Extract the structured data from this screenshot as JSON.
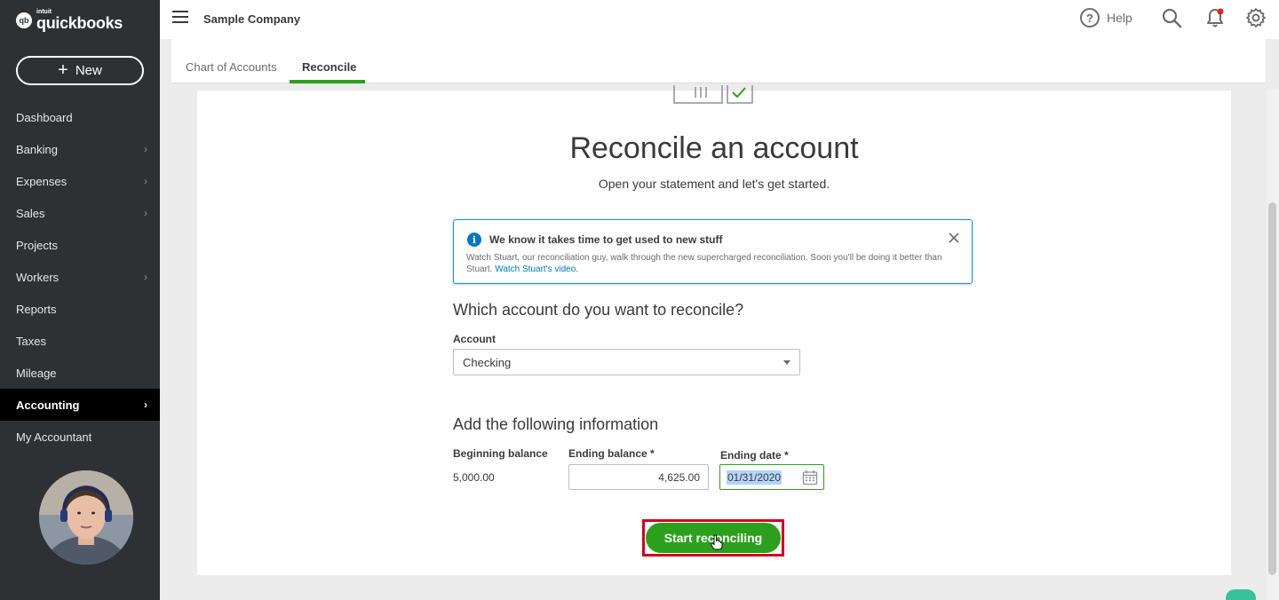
{
  "logo": {
    "intuit": "intuit",
    "brand": "quickbooks"
  },
  "sidebar": {
    "new_label": "New",
    "items": [
      {
        "label": "Dashboard",
        "chevron": false,
        "active": false
      },
      {
        "label": "Banking",
        "chevron": true,
        "active": false
      },
      {
        "label": "Expenses",
        "chevron": true,
        "active": false
      },
      {
        "label": "Sales",
        "chevron": true,
        "active": false
      },
      {
        "label": "Projects",
        "chevron": false,
        "active": false
      },
      {
        "label": "Workers",
        "chevron": true,
        "active": false
      },
      {
        "label": "Reports",
        "chevron": false,
        "active": false
      },
      {
        "label": "Taxes",
        "chevron": false,
        "active": false
      },
      {
        "label": "Mileage",
        "chevron": false,
        "active": false
      },
      {
        "label": "Accounting",
        "chevron": true,
        "active": true
      },
      {
        "label": "My Accountant",
        "chevron": false,
        "active": false
      }
    ]
  },
  "header": {
    "company": "Sample Company",
    "help_label": "Help"
  },
  "tabs": [
    {
      "label": "Chart of Accounts",
      "active": false
    },
    {
      "label": "Reconcile",
      "active": true
    }
  ],
  "main": {
    "title": "Reconcile an account",
    "subtitle": "Open your statement and let's get started.",
    "info": {
      "title": "We know it takes time to get used to new stuff",
      "body": "Watch Stuart, our reconciliation guy, walk through the new supercharged reconciliation. Soon you'll be doing it better than Stuart.",
      "link": "Watch Stuart's video."
    },
    "question_account": "Which account do you want to reconcile?",
    "account_label": "Account",
    "account_value": "Checking",
    "question_info": "Add the following information",
    "beginning_balance_label": "Beginning balance",
    "beginning_balance_value": "5,000.00",
    "ending_balance_label": "Ending balance *",
    "ending_balance_value": "4,625.00",
    "ending_date_label": "Ending date *",
    "ending_date_value": "01/31/2020",
    "start_button": "Start reconciling"
  },
  "colors": {
    "brand_green": "#2ca01c",
    "sidebar_bg": "#2e3134",
    "info_blue": "#0077c5",
    "highlight_red": "#d0021b"
  }
}
